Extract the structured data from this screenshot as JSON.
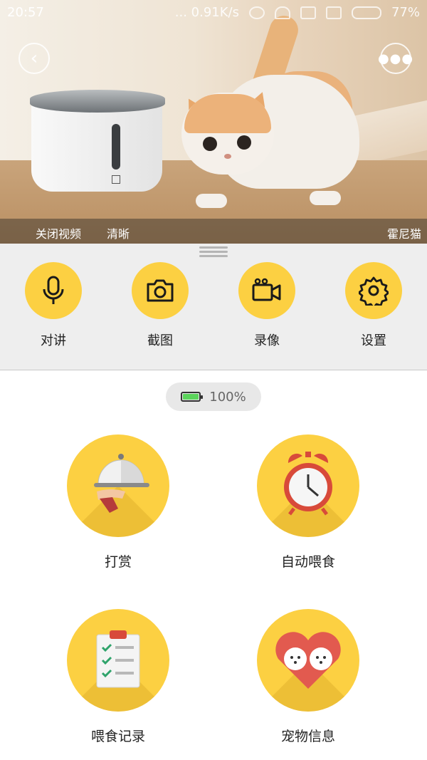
{
  "status_bar": {
    "time": "20:57",
    "network_speed": "... 0.91K/s",
    "battery": "77%"
  },
  "video": {
    "close_video_label": "关闭视频",
    "quality_label": "清晰",
    "watermark": "霍尼猫"
  },
  "controls": [
    {
      "label": "对讲",
      "icon": "microphone-icon"
    },
    {
      "label": "截图",
      "icon": "camera-icon"
    },
    {
      "label": "录像",
      "icon": "video-camera-icon"
    },
    {
      "label": "设置",
      "icon": "gear-icon"
    }
  ],
  "device_battery": {
    "percent_text": "100%",
    "level": 1.0
  },
  "features": [
    {
      "label": "打赏",
      "icon": "serving-cloche-icon"
    },
    {
      "label": "自动喂食",
      "icon": "alarm-clock-icon"
    },
    {
      "label": "喂食记录",
      "icon": "clipboard-checklist-icon"
    },
    {
      "label": "宠物信息",
      "icon": "pets-heart-icon"
    }
  ],
  "colors": {
    "accent_yellow": "#fcd042",
    "battery_green": "#5bd45b",
    "panel_gray": "#eeeeee"
  }
}
